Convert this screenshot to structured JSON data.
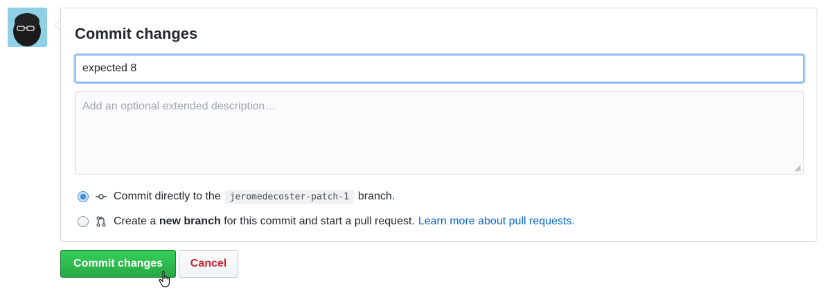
{
  "form": {
    "title": "Commit changes",
    "summary_value": "expected 8",
    "description_placeholder": "Add an optional extended description…"
  },
  "options": {
    "direct": {
      "selected": true,
      "prefix": "Commit directly to the",
      "branch": "jeromedecoster-patch-1",
      "suffix": "branch.",
      "icon": "git-commit-icon"
    },
    "new_branch": {
      "selected": false,
      "prefix": "Create a",
      "bold": "new branch",
      "middle": "for this commit and start a pull request.",
      "link": "Learn more about pull requests.",
      "icon": "git-pull-request-icon"
    }
  },
  "actions": {
    "commit_label": "Commit changes",
    "cancel_label": "Cancel"
  },
  "colors": {
    "commit_button": "#28a745",
    "cancel_text": "#cb2431",
    "link": "#0366d6",
    "focus_border": "#2188ff"
  }
}
